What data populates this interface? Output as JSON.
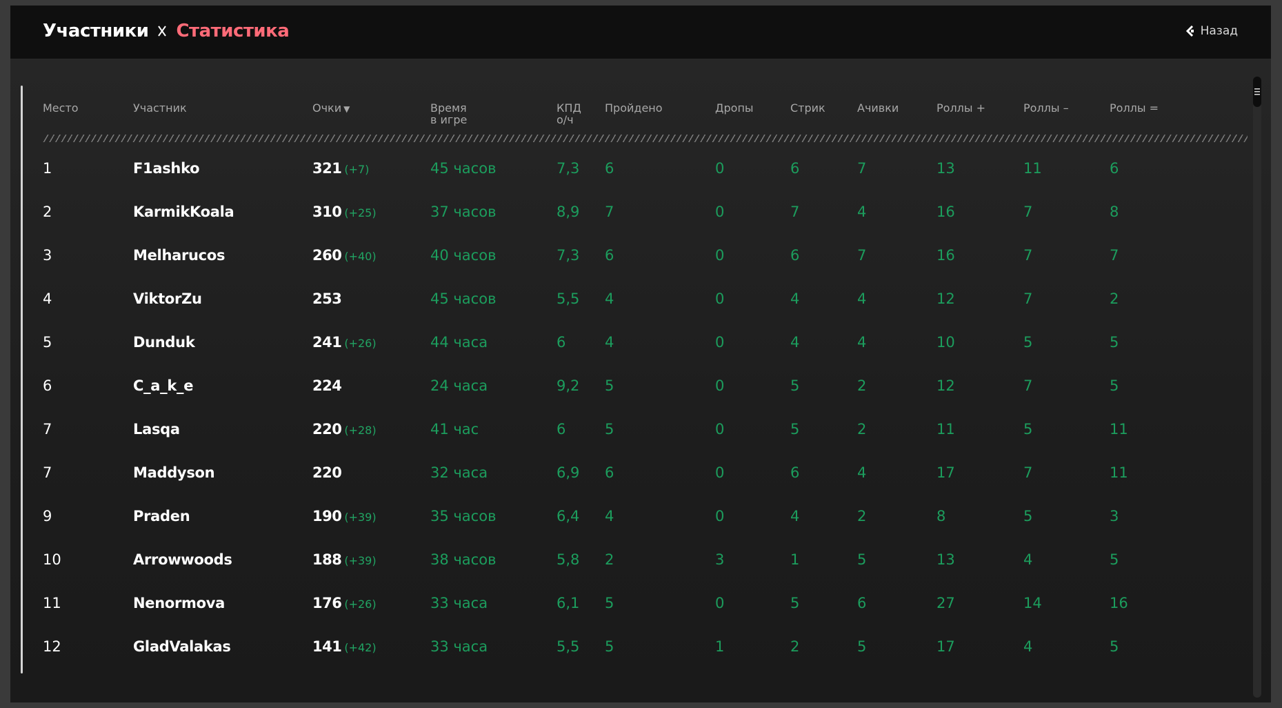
{
  "breadcrumb": {
    "parent": "Участники",
    "current": "Статистика"
  },
  "nav": {
    "back_label": "Назад"
  },
  "colors": {
    "accent": "#ff6b78",
    "stat_green": "#1c9d5d",
    "background": "#1c1c1c"
  },
  "table": {
    "headers": {
      "place": "Место",
      "participant": "Участник",
      "points": "Очки",
      "time_line1": "Время",
      "time_line2": "в игре",
      "kpd_line1": "КПД",
      "kpd_line2": "о/ч",
      "passed": "Пройдено",
      "drops": "Дропы",
      "streak": "Стрик",
      "achievements": "Ачивки",
      "rolls_plus": "Роллы +",
      "rolls_minus": "Роллы –",
      "rolls_equal": "Роллы ="
    },
    "sort_indicator": "▼",
    "rows": [
      {
        "place": "1",
        "name": "F1ashko",
        "points": "321",
        "delta": "(+7)",
        "time": "45 часов",
        "kpd": "7,3",
        "passed": "6",
        "drops": "0",
        "streak": "6",
        "achievements": "7",
        "rolls_plus": "13",
        "rolls_minus": "11",
        "rolls_equal": "6"
      },
      {
        "place": "2",
        "name": "KarmikKoala",
        "points": "310",
        "delta": "(+25)",
        "time": "37 часов",
        "kpd": "8,9",
        "passed": "7",
        "drops": "0",
        "streak": "7",
        "achievements": "4",
        "rolls_plus": "16",
        "rolls_minus": "7",
        "rolls_equal": "8"
      },
      {
        "place": "3",
        "name": "Melharucos",
        "points": "260",
        "delta": "(+40)",
        "time": "40 часов",
        "kpd": "7,3",
        "passed": "6",
        "drops": "0",
        "streak": "6",
        "achievements": "7",
        "rolls_plus": "16",
        "rolls_minus": "7",
        "rolls_equal": "7"
      },
      {
        "place": "4",
        "name": "ViktorZu",
        "points": "253",
        "delta": "",
        "time": "45 часов",
        "kpd": "5,5",
        "passed": "4",
        "drops": "0",
        "streak": "4",
        "achievements": "4",
        "rolls_plus": "12",
        "rolls_minus": "7",
        "rolls_equal": "2"
      },
      {
        "place": "5",
        "name": "Dunduk",
        "points": "241",
        "delta": "(+26)",
        "time": "44 часа",
        "kpd": "6",
        "passed": "4",
        "drops": "0",
        "streak": "4",
        "achievements": "4",
        "rolls_plus": "10",
        "rolls_minus": "5",
        "rolls_equal": "5"
      },
      {
        "place": "6",
        "name": "C_a_k_e",
        "points": "224",
        "delta": "",
        "time": "24 часа",
        "kpd": "9,2",
        "passed": "5",
        "drops": "0",
        "streak": "5",
        "achievements": "2",
        "rolls_plus": "12",
        "rolls_minus": "7",
        "rolls_equal": "5"
      },
      {
        "place": "7",
        "name": "Lasqa",
        "points": "220",
        "delta": "(+28)",
        "time": "41 час",
        "kpd": "6",
        "passed": "5",
        "drops": "0",
        "streak": "5",
        "achievements": "2",
        "rolls_plus": "11",
        "rolls_minus": "5",
        "rolls_equal": "11"
      },
      {
        "place": "7",
        "name": "Maddyson",
        "points": "220",
        "delta": "",
        "time": "32 часа",
        "kpd": "6,9",
        "passed": "6",
        "drops": "0",
        "streak": "6",
        "achievements": "4",
        "rolls_plus": "17",
        "rolls_minus": "7",
        "rolls_equal": "11"
      },
      {
        "place": "9",
        "name": "Praden",
        "points": "190",
        "delta": "(+39)",
        "time": "35 часов",
        "kpd": "6,4",
        "passed": "4",
        "drops": "0",
        "streak": "4",
        "achievements": "2",
        "rolls_plus": "8",
        "rolls_minus": "5",
        "rolls_equal": "3"
      },
      {
        "place": "10",
        "name": "Arrowwoods",
        "points": "188",
        "delta": "(+39)",
        "time": "38 часов",
        "kpd": "5,8",
        "passed": "2",
        "drops": "3",
        "streak": "1",
        "achievements": "5",
        "rolls_plus": "13",
        "rolls_minus": "4",
        "rolls_equal": "5"
      },
      {
        "place": "11",
        "name": "Nenormova",
        "points": "176",
        "delta": "(+26)",
        "time": "33 часа",
        "kpd": "6,1",
        "passed": "5",
        "drops": "0",
        "streak": "5",
        "achievements": "6",
        "rolls_plus": "27",
        "rolls_minus": "14",
        "rolls_equal": "16"
      },
      {
        "place": "12",
        "name": "GladValakas",
        "points": "141",
        "delta": "(+42)",
        "time": "33 часа",
        "kpd": "5,5",
        "passed": "5",
        "drops": "1",
        "streak": "2",
        "achievements": "5",
        "rolls_plus": "17",
        "rolls_minus": "4",
        "rolls_equal": "5"
      }
    ]
  }
}
